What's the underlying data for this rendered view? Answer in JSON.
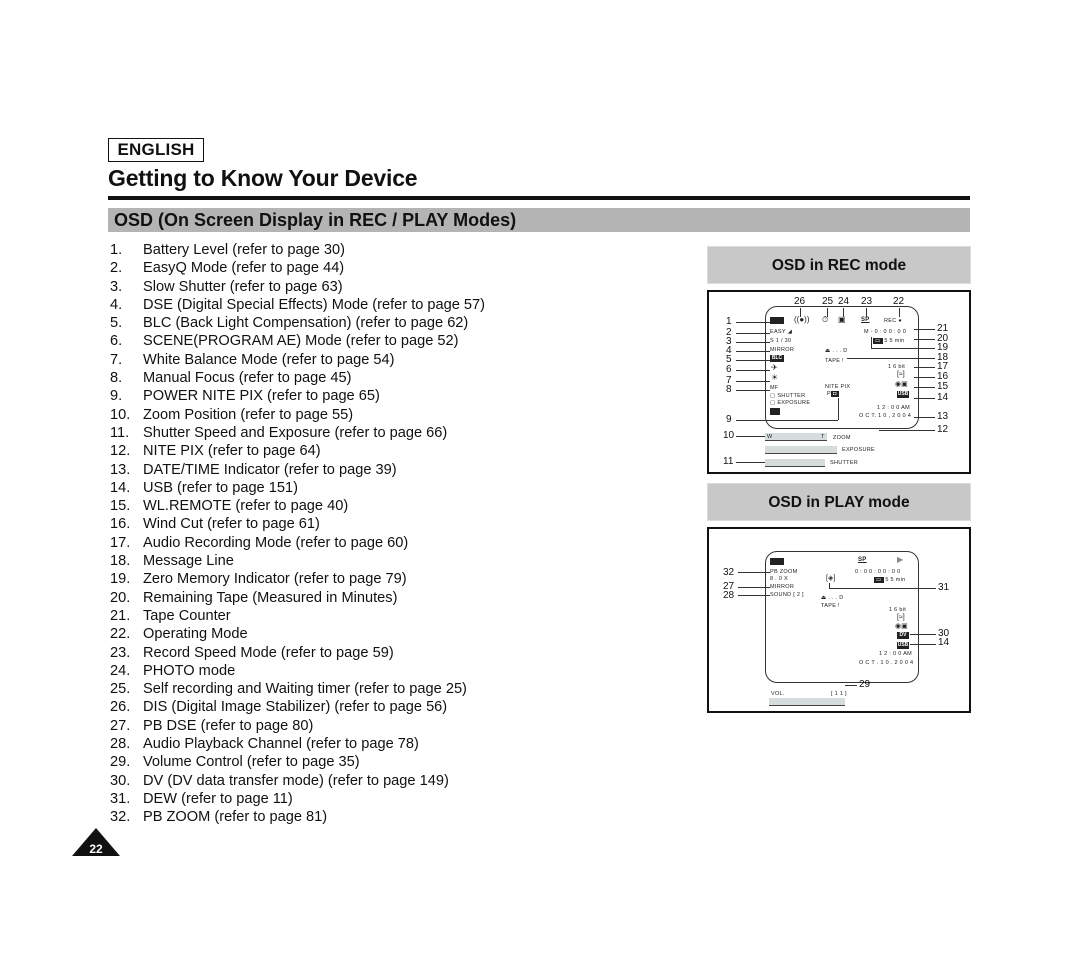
{
  "header": {
    "language_badge": "ENGLISH",
    "chapter_title": "Getting to Know Your Device",
    "section_title": "OSD (On Screen Display in REC / PLAY Modes)"
  },
  "items": [
    {
      "num": "1.",
      "text": "Battery Level (refer to page 30)"
    },
    {
      "num": "2.",
      "text": "EasyQ Mode (refer to page 44)"
    },
    {
      "num": "3.",
      "text": "Slow Shutter (refer to page 63)"
    },
    {
      "num": "4.",
      "text": "DSE (Digital Special Effects) Mode (refer to page 57)"
    },
    {
      "num": "5.",
      "text": "BLC (Back Light Compensation) (refer to page 62)"
    },
    {
      "num": "6.",
      "text": "SCENE(PROGRAM AE) Mode (refer to page 52)"
    },
    {
      "num": "7.",
      "text": "White Balance Mode (refer to page 54)"
    },
    {
      "num": "8.",
      "text": "Manual Focus (refer to page 45)"
    },
    {
      "num": "9.",
      "text": "POWER NITE PIX (refer to page 65)"
    },
    {
      "num": "10.",
      "text": "Zoom Position (refer to page 55)"
    },
    {
      "num": "11.",
      "text": "Shutter Speed and Exposure (refer to page 66)"
    },
    {
      "num": "12.",
      "text": "NITE PIX (refer to page 64)"
    },
    {
      "num": "13.",
      "text": "DATE/TIME Indicator (refer to page 39)"
    },
    {
      "num": "14.",
      "text": "USB (refer to page 151)"
    },
    {
      "num": "15.",
      "text": "WL.REMOTE (refer to page 40)"
    },
    {
      "num": "16.",
      "text": "Wind Cut (refer to page 61)"
    },
    {
      "num": "17.",
      "text": "Audio Recording Mode (refer to page 60)"
    },
    {
      "num": "18.",
      "text": "Message Line"
    },
    {
      "num": "19.",
      "text": "Zero Memory Indicator (refer to page 79)"
    },
    {
      "num": "20.",
      "text": "Remaining Tape (Measured in Minutes)"
    },
    {
      "num": "21.",
      "text": "Tape Counter"
    },
    {
      "num": "22.",
      "text": "Operating Mode"
    },
    {
      "num": "23.",
      "text": "Record Speed Mode (refer to page 59)"
    },
    {
      "num": "24.",
      "text": "PHOTO mode"
    },
    {
      "num": "25.",
      "text": "Self recording and Waiting timer (refer to page 25)"
    },
    {
      "num": "26.",
      "text": "DIS (Digital Image Stabilizer) (refer to page 56)"
    },
    {
      "num": "27.",
      "text": "PB DSE (refer to page 80)"
    },
    {
      "num": "28.",
      "text": "Audio Playback Channel (refer to page 78)"
    },
    {
      "num": "29.",
      "text": "Volume Control (refer to page 35)"
    },
    {
      "num": "30.",
      "text": "DV (DV data transfer mode) (refer to page 149)"
    },
    {
      "num": "31.",
      "text": "DEW (refer to page 11)"
    },
    {
      "num": "32.",
      "text": "PB ZOOM (refer to page 81)"
    }
  ],
  "rec_panel": {
    "heading": "OSD in REC mode",
    "callouts_top": [
      "26",
      "25",
      "24",
      "23",
      "22"
    ],
    "callouts_left": [
      "1",
      "2",
      "3",
      "4",
      "5",
      "6",
      "7",
      "8",
      "9",
      "10",
      "11"
    ],
    "callouts_right": [
      "21",
      "20",
      "19",
      "18",
      "17",
      "16",
      "15",
      "14",
      "13",
      "12"
    ],
    "osd": {
      "easy": "EASY",
      "slow_shutter": "S 1 / 30",
      "mirror": "MIRROR",
      "blc": "BLC",
      "mf": "MF",
      "shutter_item": "SHUTTER",
      "exposure_item": "EXPOSURE",
      "nite_pix": "NITE PIX",
      "power_nite_p": "P",
      "rec_label": "REC",
      "sp": "SP",
      "tape_counter": "M - 0 : 0 0 : 0 0",
      "remaining": "5 5 min",
      "zero_mem": "⏏ . . . D",
      "message": "TAPE !",
      "audio_bits": "1 6 bit",
      "usb": "USB",
      "time": "1 2 : 0 0 AM",
      "date": "O C T. 1 0 , 2 0 0 4",
      "zoom_label": "ZOOM",
      "exposure_label": "EXPOSURE",
      "shutter_label": "SHUTTER",
      "zoom_w": "W",
      "zoom_t": "T"
    }
  },
  "play_panel": {
    "heading": "OSD in PLAY mode",
    "callouts_left": [
      "32",
      "27",
      "28"
    ],
    "callouts_right": [
      "31",
      "30",
      "14",
      "29"
    ],
    "osd": {
      "pb_zoom": "PB ZOOM",
      "zoom_factor": "8 . 0 X",
      "mirror": "MIRROR",
      "sound": "SOUND [ 2 ]",
      "sp": "SP",
      "tape_counter": "0 : 0 0 : 0 0 : 0 0",
      "remaining": "5 5 min",
      "zero_mem": "⏏ . . . D",
      "message": "TAPE !",
      "audio_bits": "1 6 bit",
      "dv": "DV",
      "usb": "USB",
      "time": "1 2 : 0 0 AM",
      "date": "O C T . 1 0 . 2 0 0 4",
      "vol_label": "VOL.",
      "vol_value": "[ 1 1 ]"
    }
  },
  "footer": {
    "page_number": "22"
  }
}
